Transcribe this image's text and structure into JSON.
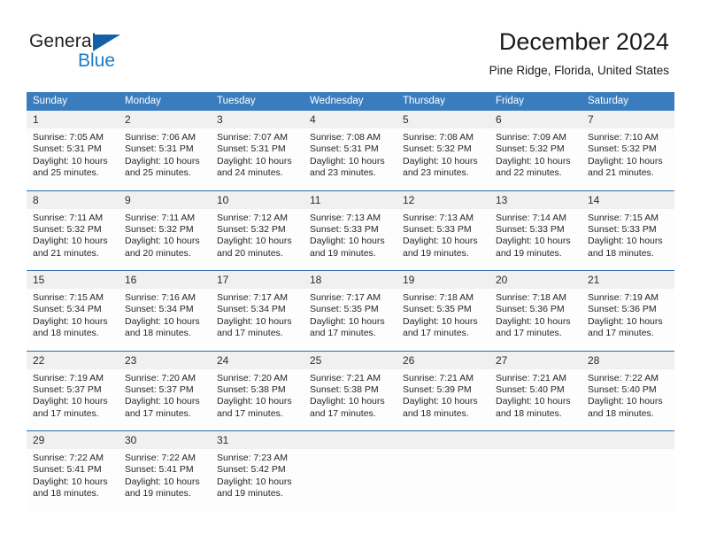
{
  "brand": {
    "name_part1": "General",
    "name_part2": "Blue",
    "triangle_color": "#1460a8",
    "blue_color": "#1e7bc4"
  },
  "header": {
    "title": "December 2024",
    "location": "Pine Ridge, Florida, United States"
  },
  "theme": {
    "header_bar": "#3a7dbf",
    "rule": "#2e6da8",
    "daynum_band": "#f0f0f0"
  },
  "weekdays": [
    "Sunday",
    "Monday",
    "Tuesday",
    "Wednesday",
    "Thursday",
    "Friday",
    "Saturday"
  ],
  "weeks": [
    [
      {
        "day": "1",
        "sunrise": "Sunrise: 7:05 AM",
        "sunset": "Sunset: 5:31 PM",
        "daylight1": "Daylight: 10 hours",
        "daylight2": "and 25 minutes."
      },
      {
        "day": "2",
        "sunrise": "Sunrise: 7:06 AM",
        "sunset": "Sunset: 5:31 PM",
        "daylight1": "Daylight: 10 hours",
        "daylight2": "and 25 minutes."
      },
      {
        "day": "3",
        "sunrise": "Sunrise: 7:07 AM",
        "sunset": "Sunset: 5:31 PM",
        "daylight1": "Daylight: 10 hours",
        "daylight2": "and 24 minutes."
      },
      {
        "day": "4",
        "sunrise": "Sunrise: 7:08 AM",
        "sunset": "Sunset: 5:31 PM",
        "daylight1": "Daylight: 10 hours",
        "daylight2": "and 23 minutes."
      },
      {
        "day": "5",
        "sunrise": "Sunrise: 7:08 AM",
        "sunset": "Sunset: 5:32 PM",
        "daylight1": "Daylight: 10 hours",
        "daylight2": "and 23 minutes."
      },
      {
        "day": "6",
        "sunrise": "Sunrise: 7:09 AM",
        "sunset": "Sunset: 5:32 PM",
        "daylight1": "Daylight: 10 hours",
        "daylight2": "and 22 minutes."
      },
      {
        "day": "7",
        "sunrise": "Sunrise: 7:10 AM",
        "sunset": "Sunset: 5:32 PM",
        "daylight1": "Daylight: 10 hours",
        "daylight2": "and 21 minutes."
      }
    ],
    [
      {
        "day": "8",
        "sunrise": "Sunrise: 7:11 AM",
        "sunset": "Sunset: 5:32 PM",
        "daylight1": "Daylight: 10 hours",
        "daylight2": "and 21 minutes."
      },
      {
        "day": "9",
        "sunrise": "Sunrise: 7:11 AM",
        "sunset": "Sunset: 5:32 PM",
        "daylight1": "Daylight: 10 hours",
        "daylight2": "and 20 minutes."
      },
      {
        "day": "10",
        "sunrise": "Sunrise: 7:12 AM",
        "sunset": "Sunset: 5:32 PM",
        "daylight1": "Daylight: 10 hours",
        "daylight2": "and 20 minutes."
      },
      {
        "day": "11",
        "sunrise": "Sunrise: 7:13 AM",
        "sunset": "Sunset: 5:33 PM",
        "daylight1": "Daylight: 10 hours",
        "daylight2": "and 19 minutes."
      },
      {
        "day": "12",
        "sunrise": "Sunrise: 7:13 AM",
        "sunset": "Sunset: 5:33 PM",
        "daylight1": "Daylight: 10 hours",
        "daylight2": "and 19 minutes."
      },
      {
        "day": "13",
        "sunrise": "Sunrise: 7:14 AM",
        "sunset": "Sunset: 5:33 PM",
        "daylight1": "Daylight: 10 hours",
        "daylight2": "and 19 minutes."
      },
      {
        "day": "14",
        "sunrise": "Sunrise: 7:15 AM",
        "sunset": "Sunset: 5:33 PM",
        "daylight1": "Daylight: 10 hours",
        "daylight2": "and 18 minutes."
      }
    ],
    [
      {
        "day": "15",
        "sunrise": "Sunrise: 7:15 AM",
        "sunset": "Sunset: 5:34 PM",
        "daylight1": "Daylight: 10 hours",
        "daylight2": "and 18 minutes."
      },
      {
        "day": "16",
        "sunrise": "Sunrise: 7:16 AM",
        "sunset": "Sunset: 5:34 PM",
        "daylight1": "Daylight: 10 hours",
        "daylight2": "and 18 minutes."
      },
      {
        "day": "17",
        "sunrise": "Sunrise: 7:17 AM",
        "sunset": "Sunset: 5:34 PM",
        "daylight1": "Daylight: 10 hours",
        "daylight2": "and 17 minutes."
      },
      {
        "day": "18",
        "sunrise": "Sunrise: 7:17 AM",
        "sunset": "Sunset: 5:35 PM",
        "daylight1": "Daylight: 10 hours",
        "daylight2": "and 17 minutes."
      },
      {
        "day": "19",
        "sunrise": "Sunrise: 7:18 AM",
        "sunset": "Sunset: 5:35 PM",
        "daylight1": "Daylight: 10 hours",
        "daylight2": "and 17 minutes."
      },
      {
        "day": "20",
        "sunrise": "Sunrise: 7:18 AM",
        "sunset": "Sunset: 5:36 PM",
        "daylight1": "Daylight: 10 hours",
        "daylight2": "and 17 minutes."
      },
      {
        "day": "21",
        "sunrise": "Sunrise: 7:19 AM",
        "sunset": "Sunset: 5:36 PM",
        "daylight1": "Daylight: 10 hours",
        "daylight2": "and 17 minutes."
      }
    ],
    [
      {
        "day": "22",
        "sunrise": "Sunrise: 7:19 AM",
        "sunset": "Sunset: 5:37 PM",
        "daylight1": "Daylight: 10 hours",
        "daylight2": "and 17 minutes."
      },
      {
        "day": "23",
        "sunrise": "Sunrise: 7:20 AM",
        "sunset": "Sunset: 5:37 PM",
        "daylight1": "Daylight: 10 hours",
        "daylight2": "and 17 minutes."
      },
      {
        "day": "24",
        "sunrise": "Sunrise: 7:20 AM",
        "sunset": "Sunset: 5:38 PM",
        "daylight1": "Daylight: 10 hours",
        "daylight2": "and 17 minutes."
      },
      {
        "day": "25",
        "sunrise": "Sunrise: 7:21 AM",
        "sunset": "Sunset: 5:38 PM",
        "daylight1": "Daylight: 10 hours",
        "daylight2": "and 17 minutes."
      },
      {
        "day": "26",
        "sunrise": "Sunrise: 7:21 AM",
        "sunset": "Sunset: 5:39 PM",
        "daylight1": "Daylight: 10 hours",
        "daylight2": "and 18 minutes."
      },
      {
        "day": "27",
        "sunrise": "Sunrise: 7:21 AM",
        "sunset": "Sunset: 5:40 PM",
        "daylight1": "Daylight: 10 hours",
        "daylight2": "and 18 minutes."
      },
      {
        "day": "28",
        "sunrise": "Sunrise: 7:22 AM",
        "sunset": "Sunset: 5:40 PM",
        "daylight1": "Daylight: 10 hours",
        "daylight2": "and 18 minutes."
      }
    ],
    [
      {
        "day": "29",
        "sunrise": "Sunrise: 7:22 AM",
        "sunset": "Sunset: 5:41 PM",
        "daylight1": "Daylight: 10 hours",
        "daylight2": "and 18 minutes."
      },
      {
        "day": "30",
        "sunrise": "Sunrise: 7:22 AM",
        "sunset": "Sunset: 5:41 PM",
        "daylight1": "Daylight: 10 hours",
        "daylight2": "and 19 minutes."
      },
      {
        "day": "31",
        "sunrise": "Sunrise: 7:23 AM",
        "sunset": "Sunset: 5:42 PM",
        "daylight1": "Daylight: 10 hours",
        "daylight2": "and 19 minutes."
      },
      {
        "day": "",
        "sunrise": "",
        "sunset": "",
        "daylight1": "",
        "daylight2": ""
      },
      {
        "day": "",
        "sunrise": "",
        "sunset": "",
        "daylight1": "",
        "daylight2": ""
      },
      {
        "day": "",
        "sunrise": "",
        "sunset": "",
        "daylight1": "",
        "daylight2": ""
      },
      {
        "day": "",
        "sunrise": "",
        "sunset": "",
        "daylight1": "",
        "daylight2": ""
      }
    ]
  ]
}
